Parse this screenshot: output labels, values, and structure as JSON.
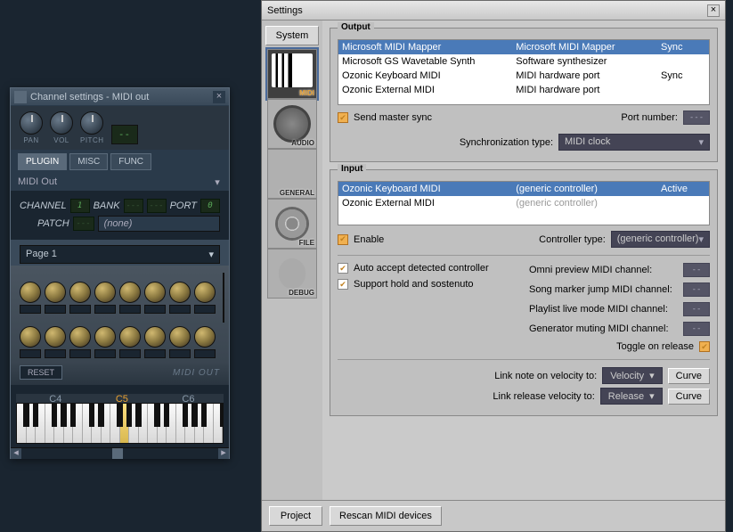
{
  "channel_window": {
    "title": "Channel settings - MIDI out",
    "top_knobs": [
      {
        "label": "PAN"
      },
      {
        "label": "VOL"
      },
      {
        "label": "PITCH"
      }
    ],
    "lcd_value": "--",
    "tabs": [
      {
        "label": "PLUGIN",
        "active": true
      },
      {
        "label": "MISC",
        "active": false
      },
      {
        "label": "FUNC",
        "active": false
      }
    ],
    "plugin_name": "MIDI Out",
    "params": {
      "channel_label": "CHANNEL",
      "channel_value": "1",
      "bank_label": "BANK",
      "bank_value1": "---",
      "bank_value2": "---",
      "port_label": "PORT",
      "port_value": "0",
      "patch_label": "PATCH",
      "patch_value": "---",
      "patch_name": "(none)"
    },
    "page_label": "Page 1",
    "reset_label": "RESET",
    "brand_label": "MIDI OUT",
    "octaves": [
      "C4",
      "C5",
      "C6"
    ]
  },
  "settings_window": {
    "title": "Settings",
    "system_btn": "System",
    "project_btn": "Project",
    "categories": [
      {
        "id": "midi",
        "label": "MIDI",
        "active": true
      },
      {
        "id": "audio",
        "label": "AUDIO",
        "active": false
      },
      {
        "id": "general",
        "label": "GENERAL",
        "active": false
      },
      {
        "id": "file",
        "label": "FILE",
        "active": false
      },
      {
        "id": "debug",
        "label": "DEBUG",
        "active": false
      }
    ],
    "output": {
      "title": "Output",
      "rows": [
        {
          "name": "Microsoft MIDI Mapper",
          "type": "Microsoft MIDI Mapper",
          "sync": "Sync",
          "sel": true
        },
        {
          "name": "Microsoft GS Wavetable Synth",
          "type": "Software synthesizer",
          "sync": "",
          "sel": false
        },
        {
          "name": "Ozonic Keyboard MIDI",
          "type": "MIDI hardware port",
          "sync": "Sync",
          "sel": false
        },
        {
          "name": "Ozonic External MIDI",
          "type": "MIDI hardware port",
          "sync": "",
          "sel": false
        }
      ],
      "send_sync_label": "Send master sync",
      "send_sync_on": true,
      "port_number_label": "Port number:",
      "port_number_value": "---",
      "sync_type_label": "Synchronization type:",
      "sync_type_value": "MIDI clock"
    },
    "input": {
      "title": "Input",
      "rows": [
        {
          "name": "Ozonic Keyboard MIDI",
          "type": "(generic controller)",
          "status": "Active",
          "sel": true
        },
        {
          "name": "Ozonic External MIDI",
          "type": "(generic controller)",
          "status": "",
          "sel": false
        }
      ],
      "enable_label": "Enable",
      "enable_on": true,
      "controller_type_label": "Controller type:",
      "controller_type_value": "(generic controller)",
      "auto_accept_label": "Auto accept detected controller",
      "auto_accept_on": true,
      "sostenuto_label": "Support hold and sostenuto",
      "sostenuto_on": true,
      "omni_label": "Omni preview MIDI channel:",
      "omni_value": "--",
      "marker_label": "Song marker jump MIDI channel:",
      "marker_value": "--",
      "playlist_label": "Playlist live mode MIDI channel:",
      "playlist_value": "--",
      "genmute_label": "Generator muting MIDI channel:",
      "genmute_value": "--",
      "toggle_release_label": "Toggle on release",
      "toggle_release_on": true,
      "link_note_label": "Link note on velocity to:",
      "link_note_value": "Velocity",
      "link_release_label": "Link release velocity to:",
      "link_release_value": "Release",
      "curve_label": "Curve"
    },
    "rescan_label": "Rescan MIDI devices"
  }
}
